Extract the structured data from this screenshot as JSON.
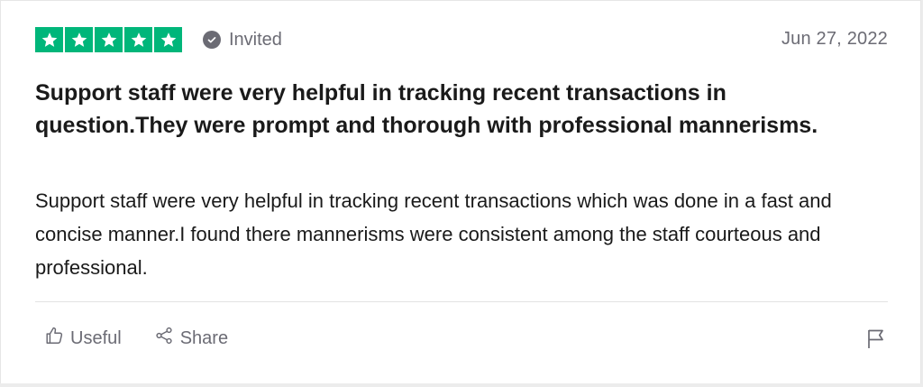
{
  "review": {
    "rating": 5,
    "rating_max": 5,
    "star_color": "#00b67a",
    "invited_label": "Invited",
    "date": "Jun 27, 2022",
    "title": "Support staff were very helpful in tracking recent transactions in question.They were prompt and thorough with professional mannerisms.",
    "body": "Support staff were very helpful in tracking recent transactions which was done in a fast and concise manner.I found there mannerisms were consistent among the staff courteous and professional."
  },
  "actions": {
    "useful_label": "Useful",
    "useful_icon": "thumbs-up-icon",
    "share_label": "Share",
    "share_icon": "share-icon",
    "flag_icon": "flag-icon"
  }
}
